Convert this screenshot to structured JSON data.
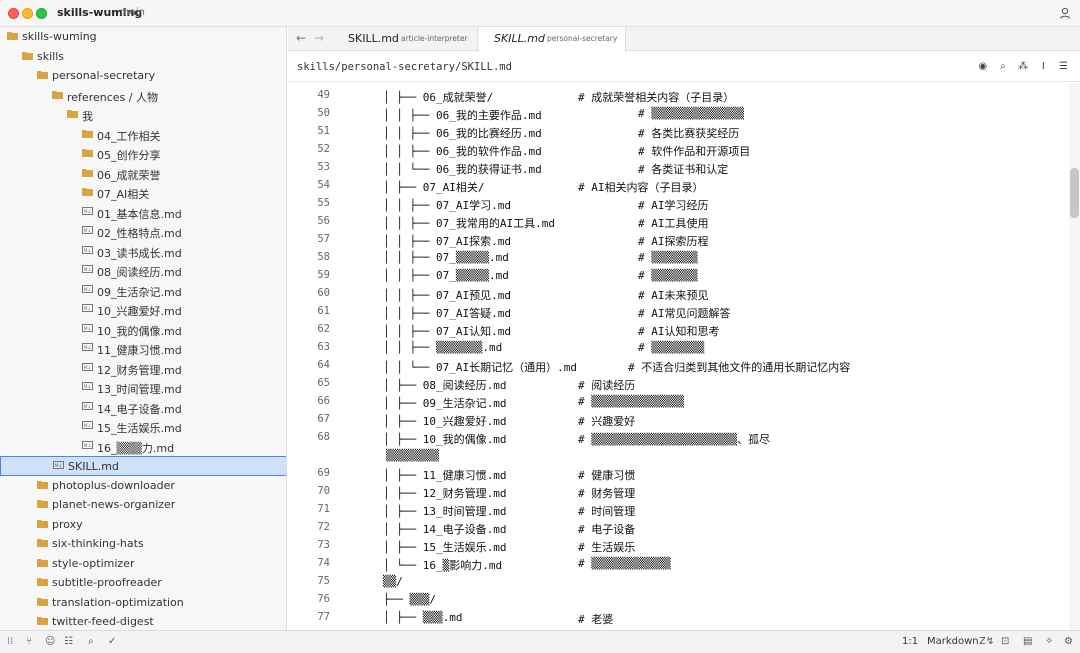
{
  "app": {
    "title": "skills-wuming",
    "branch": "main"
  },
  "tabs": [
    {
      "name": "SKILL.md",
      "sub": "article-interpreter"
    },
    {
      "name": "SKILL.md",
      "sub": "personal-secretary"
    }
  ],
  "path": "skills/personal-secretary/SKILL.md",
  "sidebar": {
    "items": [
      {
        "label": "skills-wuming",
        "kind": "folder",
        "indent": 0
      },
      {
        "label": "skills",
        "kind": "folder",
        "indent": 1
      },
      {
        "label": "personal-secretary",
        "kind": "folder",
        "indent": 2
      },
      {
        "label": "references / 人物",
        "kind": "folder",
        "indent": 3
      },
      {
        "label": "我",
        "kind": "folder",
        "indent": 4
      },
      {
        "label": "04_工作相关",
        "kind": "folder",
        "indent": 5
      },
      {
        "label": "05_创作分享",
        "kind": "folder",
        "indent": 5
      },
      {
        "label": "06_成就荣誉",
        "kind": "folder",
        "indent": 5
      },
      {
        "label": "07_AI相关",
        "kind": "folder",
        "indent": 5
      },
      {
        "label": "01_基本信息.md",
        "kind": "file",
        "indent": 5
      },
      {
        "label": "02_性格特点.md",
        "kind": "file",
        "indent": 5
      },
      {
        "label": "03_读书成长.md",
        "kind": "file",
        "indent": 5
      },
      {
        "label": "08_阅读经历.md",
        "kind": "file",
        "indent": 5
      },
      {
        "label": "09_生活杂记.md",
        "kind": "file",
        "indent": 5
      },
      {
        "label": "10_兴趣爱好.md",
        "kind": "file",
        "indent": 5
      },
      {
        "label": "10_我的偶像.md",
        "kind": "file",
        "indent": 5
      },
      {
        "label": "11_健康习惯.md",
        "kind": "file",
        "indent": 5
      },
      {
        "label": "12_财务管理.md",
        "kind": "file",
        "indent": 5
      },
      {
        "label": "13_时间管理.md",
        "kind": "file",
        "indent": 5
      },
      {
        "label": "14_电子设备.md",
        "kind": "file",
        "indent": 5
      },
      {
        "label": "15_生活娱乐.md",
        "kind": "file",
        "indent": 5
      },
      {
        "label": "16_▒▒▒力.md",
        "kind": "file",
        "indent": 5
      },
      {
        "label": "SKILL.md",
        "kind": "file",
        "indent": 3,
        "selected": true
      },
      {
        "label": "photoplus-downloader",
        "kind": "folder",
        "indent": 2
      },
      {
        "label": "planet-news-organizer",
        "kind": "folder",
        "indent": 2
      },
      {
        "label": "proxy",
        "kind": "folder",
        "indent": 2
      },
      {
        "label": "six-thinking-hats",
        "kind": "folder",
        "indent": 2
      },
      {
        "label": "style-optimizer",
        "kind": "folder",
        "indent": 2
      },
      {
        "label": "subtitle-proofreader",
        "kind": "folder",
        "indent": 2
      },
      {
        "label": "translation-optimization",
        "kind": "folder",
        "indent": 2
      },
      {
        "label": "twitter-feed-digest",
        "kind": "folder",
        "indent": 2
      }
    ]
  },
  "editor": {
    "lines": [
      {
        "n": "49",
        "code": "│   ├── 06_成就荣誉/",
        "comment": "# 成就荣誉相关内容（子目录）",
        "c": 290
      },
      {
        "n": "50",
        "code": "│   │   ├── 06_我的主要作品.md",
        "comment": "# ▒▒▒▒▒▒▒▒▒▒▒▒▒▒",
        "c": 350
      },
      {
        "n": "51",
        "code": "│   │   ├── 06_我的比赛经历.md",
        "comment": "# 各类比赛获奖经历",
        "c": 350
      },
      {
        "n": "52",
        "code": "│   │   ├── 06_我的软件作品.md",
        "comment": "# 软件作品和开源项目",
        "c": 350
      },
      {
        "n": "53",
        "code": "│   │   └── 06_我的获得证书.md",
        "comment": "# 各类证书和认定",
        "c": 350
      },
      {
        "n": "54",
        "code": "│   ├── 07_AI相关/",
        "comment": "# AI相关内容（子目录）",
        "c": 290
      },
      {
        "n": "55",
        "code": "│   │   ├── 07_AI学习.md",
        "comment": "# AI学习经历",
        "c": 350
      },
      {
        "n": "56",
        "code": "│   │   ├── 07_我常用的AI工具.md",
        "comment": "# AI工具使用",
        "c": 350
      },
      {
        "n": "57",
        "code": "│   │   ├── 07_AI探索.md",
        "comment": "# AI探索历程",
        "c": 350
      },
      {
        "n": "58",
        "code": "│   │   ├── 07_▒▒▒▒▒.md",
        "comment": "# ▒▒▒▒▒▒▒",
        "c": 350
      },
      {
        "n": "59",
        "code": "│   │   ├── 07_▒▒▒▒▒.md",
        "comment": "# ▒▒▒▒▒▒▒",
        "c": 350
      },
      {
        "n": "60",
        "code": "│   │   ├── 07_AI预见.md",
        "comment": "# AI未来预见",
        "c": 350
      },
      {
        "n": "61",
        "code": "│   │   ├── 07_AI答疑.md",
        "comment": "# AI常见问题解答",
        "c": 350
      },
      {
        "n": "62",
        "code": "│   │   ├── 07_AI认知.md",
        "comment": "# AI认知和思考",
        "c": 350
      },
      {
        "n": "63",
        "code": "│   │   ├── ▒▒▒▒▒▒▒.md",
        "comment": "# ▒▒▒▒▒▒▒▒",
        "c": 350
      },
      {
        "n": "64",
        "code": "│   │   └── 07_AI长期记忆（通用）.md",
        "comment": "# 不适合归类到其他文件的通用长期记忆内容",
        "c": 340
      },
      {
        "n": "65",
        "code": "│   ├── 08_阅读经历.md",
        "comment": "# 阅读经历",
        "c": 290
      },
      {
        "n": "66",
        "code": "│   ├── 09_生活杂记.md",
        "comment": "# ▒▒▒▒▒▒▒▒▒▒▒▒▒▒",
        "c": 290
      },
      {
        "n": "67",
        "code": "│   ├── 10_兴趣爱好.md",
        "comment": "# 兴趣爱好",
        "c": 290
      },
      {
        "n": "68",
        "code": "│   ├── 10_我的偶像.md",
        "comment": "# ▒▒▒▒▒▒▒▒▒▒▒▒▒▒▒▒▒▒▒▒▒▒、孤尽",
        "c": 290
      },
      {
        "n": "",
        "code": "▒▒▒▒▒▒▒▒",
        "comment": "",
        "c": 290,
        "wrap": true
      },
      {
        "n": "69",
        "code": "│   ├── 11_健康习惯.md",
        "comment": "# 健康习惯",
        "c": 290
      },
      {
        "n": "70",
        "code": "│   ├── 12_财务管理.md",
        "comment": "# 财务管理",
        "c": 290
      },
      {
        "n": "71",
        "code": "│   ├── 13_时间管理.md",
        "comment": "# 时间管理",
        "c": 290
      },
      {
        "n": "72",
        "code": "│   ├── 14_电子设备.md",
        "comment": "# 电子设备",
        "c": 290
      },
      {
        "n": "73",
        "code": "│   ├── 15_生活娱乐.md",
        "comment": "# 生活娱乐",
        "c": 290
      },
      {
        "n": "74",
        "code": "│   └── 16_▒影响力.md",
        "comment": "# ▒▒▒▒▒▒▒▒▒▒▒▒",
        "c": 290
      },
      {
        "n": "75",
        "code": "    ▒▒/",
        "comment": "",
        "c": 290
      },
      {
        "n": "76",
        "code": "    ├── ▒▒▒/",
        "comment": "",
        "c": 290
      },
      {
        "n": "77",
        "code": "    │   ├── ▒▒▒.md",
        "comment": "# 老婆",
        "c": 290
      }
    ]
  },
  "status": {
    "position": "1:1",
    "language": "Markdown"
  },
  "colors": {
    "folder": "#d8a345",
    "selection": "#cfe1fb",
    "selection_border": "#4a86e8"
  }
}
